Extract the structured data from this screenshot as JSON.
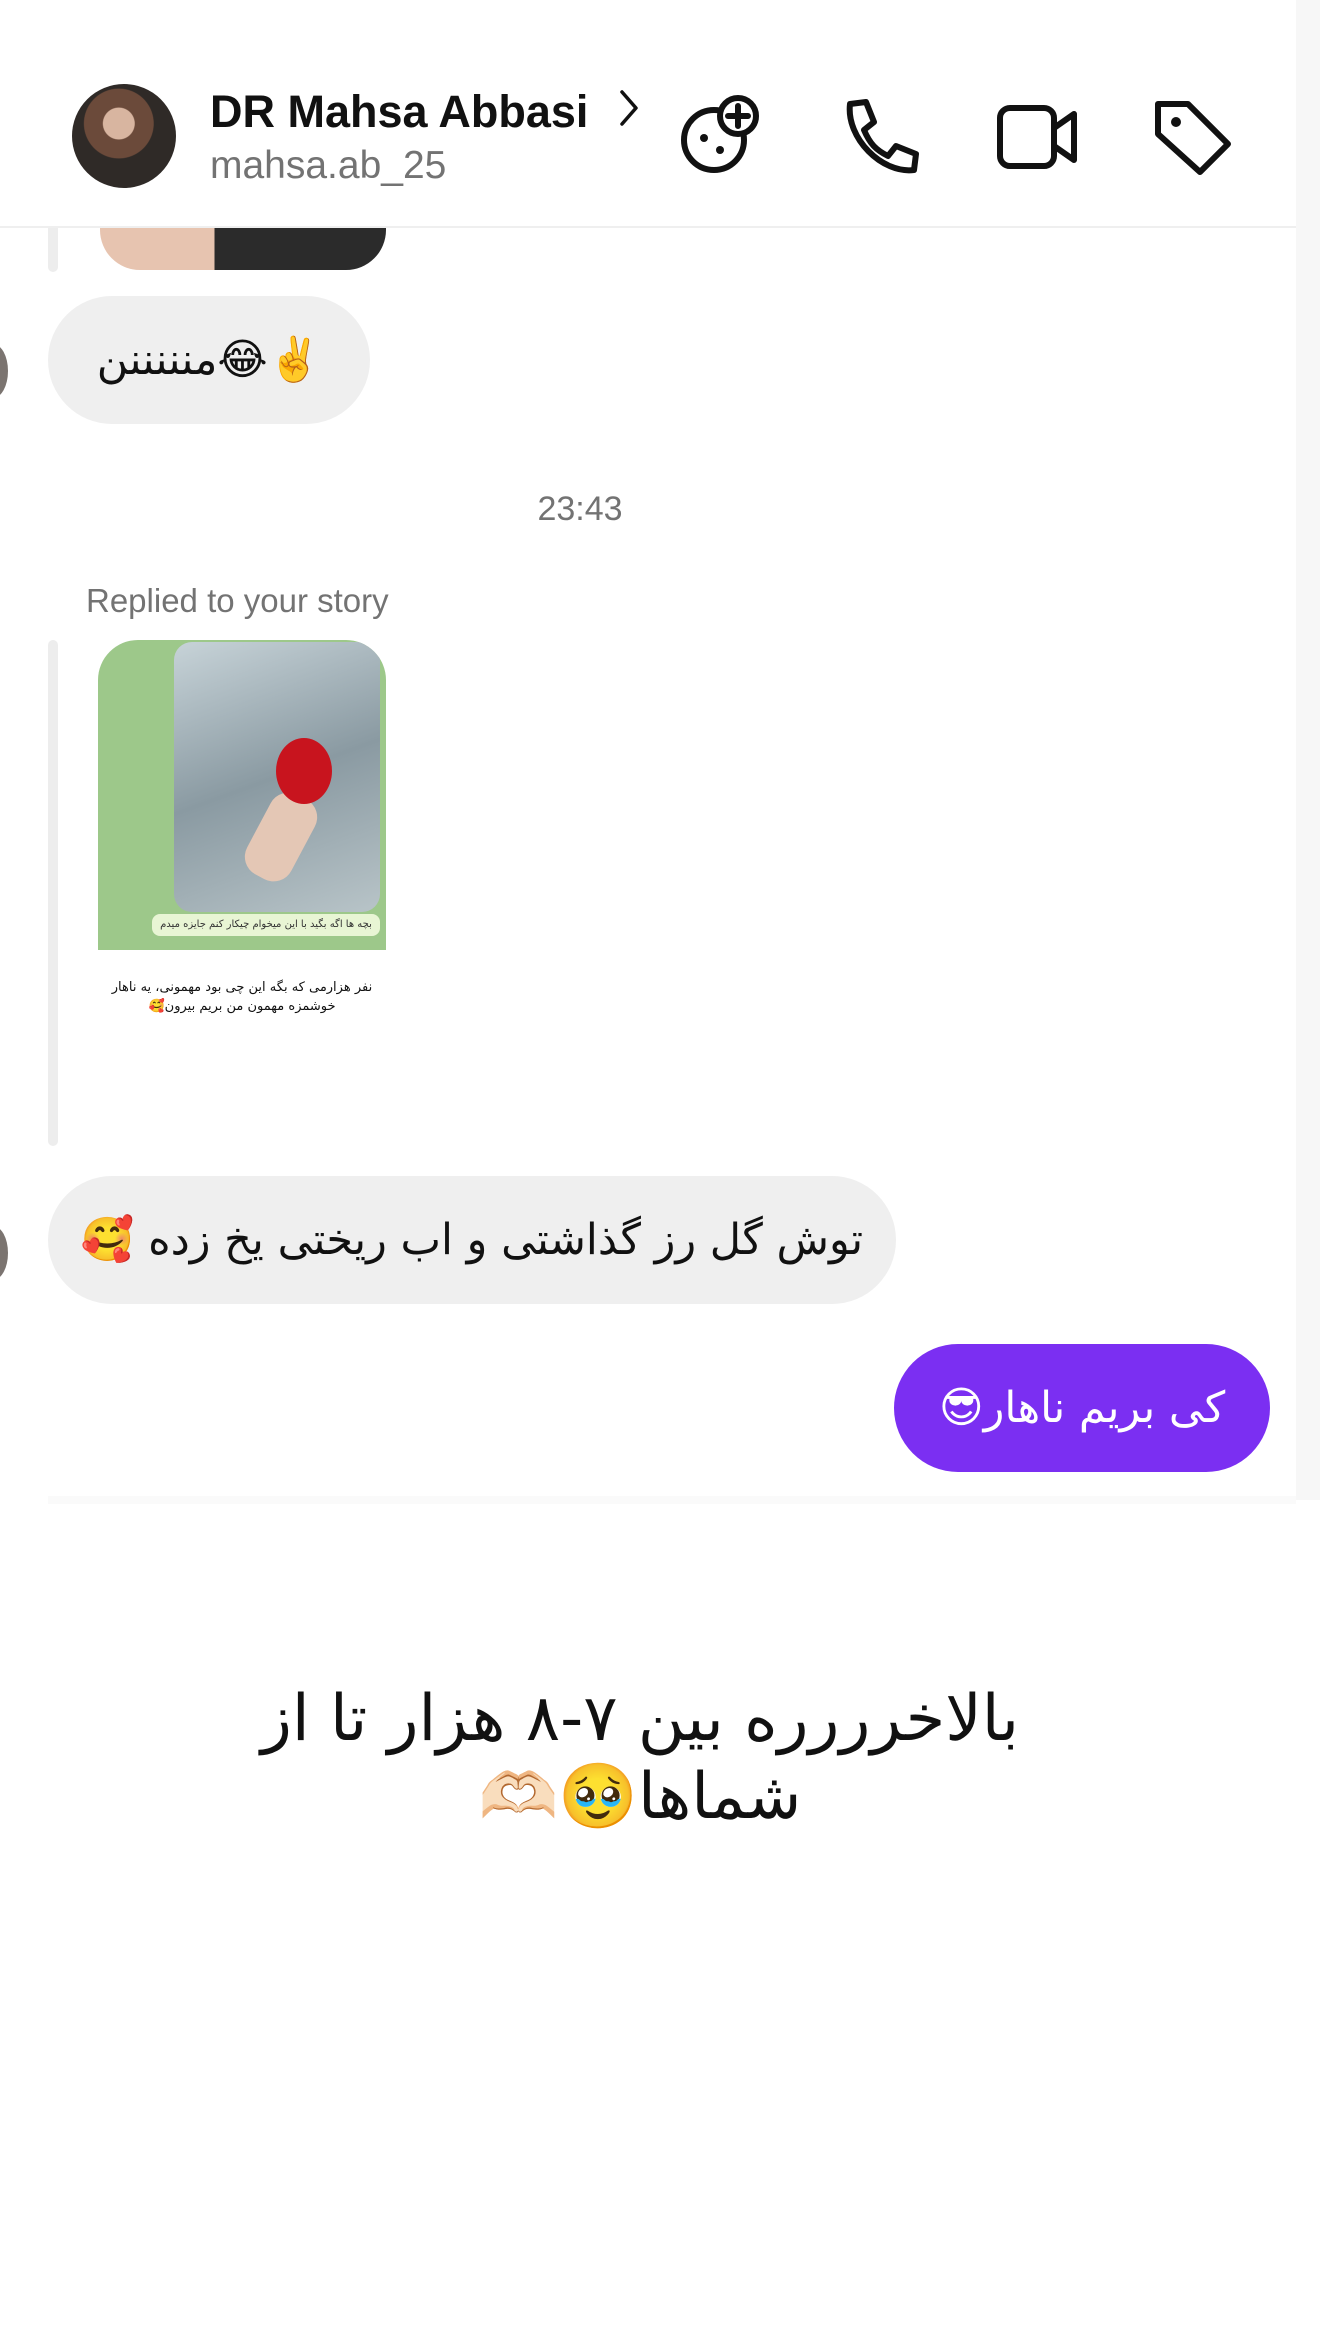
{
  "header": {
    "name": "DR Mahsa Abbasi",
    "handle": "mahsa.ab_25",
    "icons": [
      "add-effect-icon",
      "phone-icon",
      "video-call-icon",
      "tag-icon"
    ]
  },
  "messages": {
    "first_incoming": "✌️😂منننننن",
    "timestamp": "23:43",
    "replied_label": "Replied to your story",
    "story_caption": "بچه ها اگه بگید با این میخوام چیکار کنم جایزه میدم",
    "story_text": "نفر هزارمی که بگه این چی بود مهمونی، یه ناهار خوشمزه مهمون من بریم بیرون🥰",
    "second_incoming": "توش گل رز گذاشتی و اب ریختی  یخ زده 🥰",
    "outgoing": "کی بریم ناهار😎"
  },
  "overlay_text": "بالاخرررره بین ۷-۸ هزار تا از شماها🥹🫶🏻",
  "colors": {
    "outgoing_bubble": "#7b2ff2",
    "incoming_bubble": "#efefef",
    "muted_text": "#737373"
  }
}
